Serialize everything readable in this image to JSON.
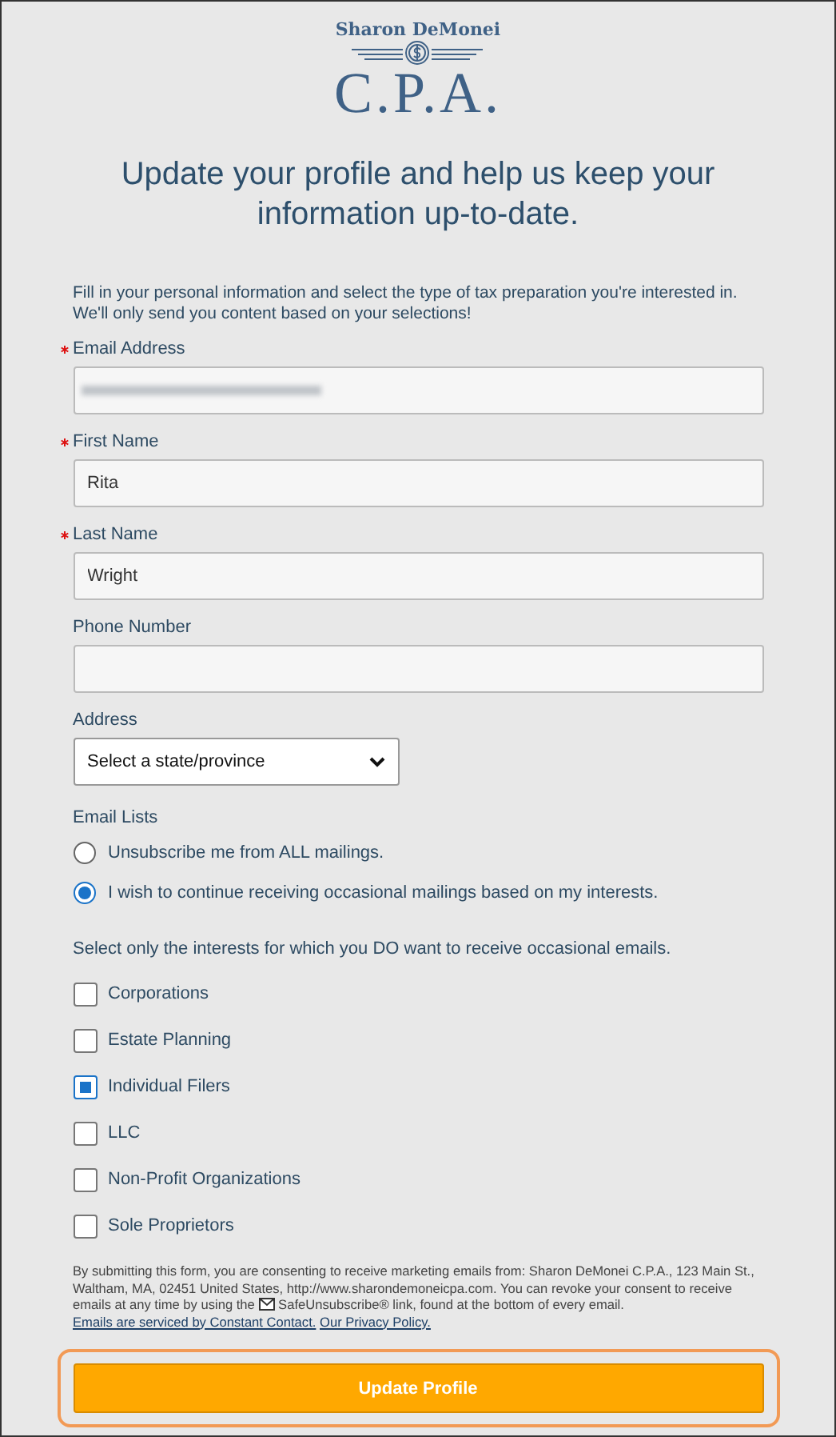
{
  "logo": {
    "name": "Sharon DeMonei",
    "title": "C.P.A."
  },
  "heading": "Update your profile and help us keep your information up-to-date.",
  "intro": "Fill in your personal information and select the type of tax preparation you're interested in. We'll only send you content based on your selections!",
  "fields": [
    {
      "label": "Email Address",
      "required": true,
      "kind": "blurred"
    },
    {
      "label": "First Name",
      "required": true,
      "kind": "text",
      "value": "Rita"
    },
    {
      "label": "Last Name",
      "required": true,
      "kind": "text",
      "value": "Wright"
    },
    {
      "label": "Phone Number",
      "required": false,
      "kind": "text"
    },
    {
      "label": "Address",
      "required": false,
      "kind": "select",
      "value": "Select a state/province"
    }
  ],
  "email_lists": {
    "label": "Email Lists",
    "options": [
      {
        "label": "Unsubscribe me from ALL mailings.",
        "selected": false
      },
      {
        "label": "I wish to continue receiving occasional mailings based on my interests.",
        "selected": true
      }
    ]
  },
  "interests_prompt": "Select only the interests for which you DO want to receive occasional emails.",
  "interests": [
    {
      "label": "Corporations",
      "checked": false
    },
    {
      "label": "Estate Planning",
      "checked": false
    },
    {
      "label": "Individual Filers",
      "checked": true
    },
    {
      "label": "LLC",
      "checked": false
    },
    {
      "label": "Non-Profit Organizations",
      "checked": false
    },
    {
      "label": "Sole Proprietors",
      "checked": false
    }
  ],
  "consent": {
    "text_1": "By submitting this form, you are consenting to receive marketing emails from: Sharon DeMonei C.P.A., 123 Main St., Waltham, MA, 02451 United States, http://www.sharondemoneicpa.com. You can revoke your consent to receive emails at any time by using the",
    "text_2": "SafeUnsubscribe® link, found at the bottom of every email.",
    "links": [
      "Emails are serviced by Constant Contact.",
      "Our Privacy Policy."
    ]
  },
  "submit": "Update Profile"
}
